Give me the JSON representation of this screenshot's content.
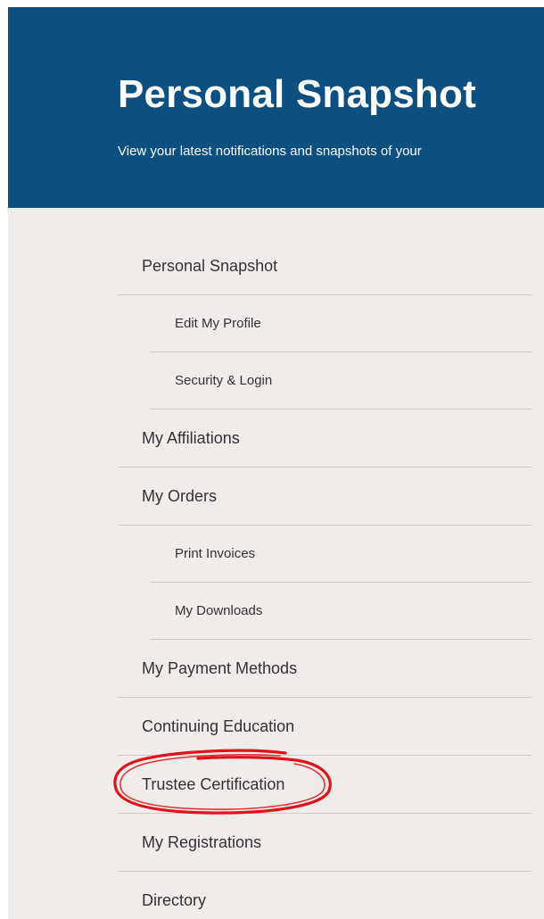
{
  "header": {
    "title": "Personal Snapshot",
    "subtitle": "View your latest notifications and snapshots of your"
  },
  "menu": {
    "items": [
      {
        "label": "Personal Snapshot"
      },
      {
        "label": "Edit My Profile"
      },
      {
        "label": "Security & Login"
      },
      {
        "label": "My Affiliations"
      },
      {
        "label": "My Orders"
      },
      {
        "label": "Print Invoices"
      },
      {
        "label": "My Downloads"
      },
      {
        "label": "My Payment Methods"
      },
      {
        "label": "Continuing Education"
      },
      {
        "label": "Trustee Certification"
      },
      {
        "label": "My Registrations"
      },
      {
        "label": "Directory"
      }
    ]
  },
  "colors": {
    "header_bg": "#0b5080",
    "content_bg": "#f0ece9",
    "highlight": "#e0131a"
  }
}
